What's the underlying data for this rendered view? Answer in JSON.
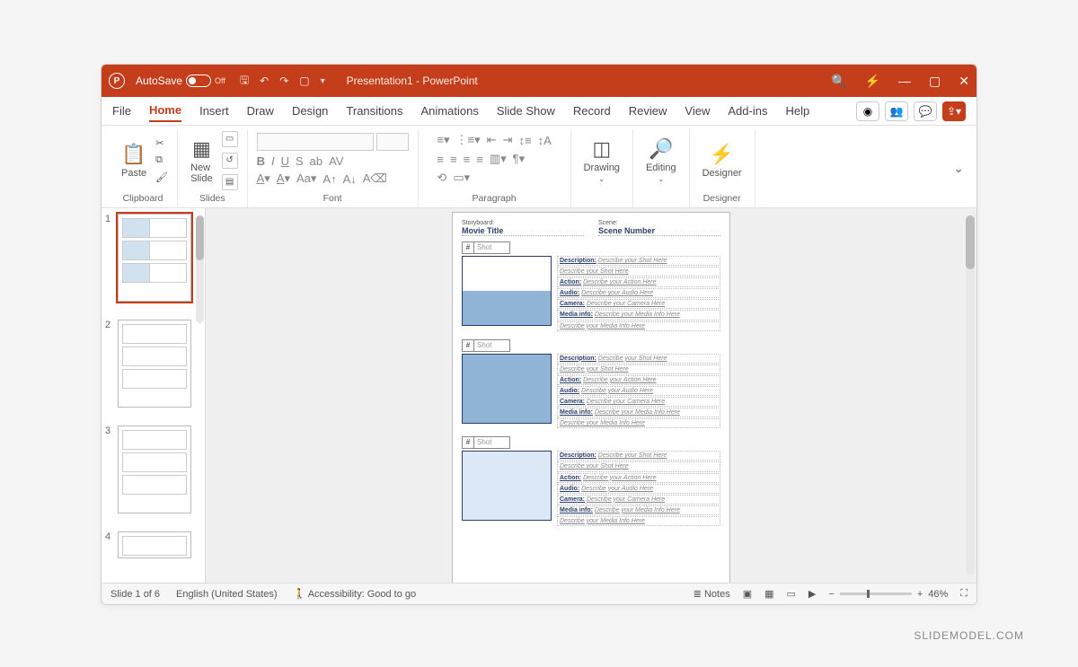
{
  "titlebar": {
    "autosave_label": "AutoSave",
    "autosave_state": "Off",
    "title": "Presentation1 - PowerPoint"
  },
  "tabs": [
    "File",
    "Home",
    "Insert",
    "Draw",
    "Design",
    "Transitions",
    "Animations",
    "Slide Show",
    "Record",
    "Review",
    "View",
    "Add-ins",
    "Help"
  ],
  "active_tab": "Home",
  "ribbon": {
    "clipboard": {
      "paste": "Paste",
      "label": "Clipboard"
    },
    "slides": {
      "new_slide": "New\nSlide",
      "label": "Slides"
    },
    "font": {
      "label": "Font"
    },
    "paragraph": {
      "label": "Paragraph"
    },
    "drawing": "Drawing",
    "editing": "Editing",
    "designer": "Designer",
    "designer_label": "Designer"
  },
  "thumbs": [
    1,
    2,
    3,
    4
  ],
  "slide": {
    "storyboard_lbl": "Storyboard:",
    "storyboard_val": "Movie Title",
    "scene_lbl": "Scene:",
    "scene_val": "Scene Number",
    "shot_hash": "#",
    "shot_lbl": "Shot",
    "desc_lbl": "Description:",
    "desc_ph": "Describe your Shot Here",
    "desc_ph2": "Describe your Shot Here",
    "action_lbl": "Action:",
    "action_ph": "Describe your Action Here",
    "audio_lbl": "Audio:",
    "audio_ph": "Describe your Audio Here",
    "camera_lbl": "Camera:",
    "camera_ph": "Describe your Camera Here",
    "media_lbl": "Media info:",
    "media_ph": "Describe your Media Info Here",
    "media_ph2": "Describe your Media Info Here"
  },
  "statusbar": {
    "slide": "Slide 1 of 6",
    "lang": "English (United States)",
    "access": "Accessibility: Good to go",
    "notes": "Notes",
    "zoom": "46%"
  },
  "watermark": "SLIDEMODEL.COM"
}
